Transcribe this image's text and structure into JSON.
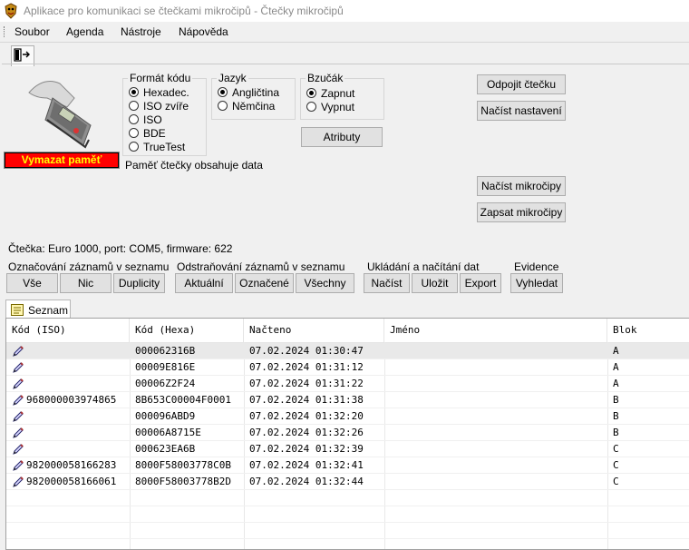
{
  "window": {
    "title": "Aplikace pro komunikaci se čtečkami mikročipů - Čtečky mikročipů"
  },
  "menu": [
    "Soubor",
    "Agenda",
    "Nástroje",
    "Nápověda"
  ],
  "erase_button": "Vymazat paměť",
  "code_format": {
    "label": "Formát kódu",
    "options": [
      "Hexadec.",
      "ISO zvíře",
      "ISO",
      "BDE",
      "TrueTest"
    ],
    "selected": 0
  },
  "language": {
    "label": "Jazyk",
    "options": [
      "Angličtina",
      "Němčina"
    ],
    "selected": 0
  },
  "beeper": {
    "label": "Bzučák",
    "options": [
      "Zapnut",
      "Vypnut"
    ],
    "selected": 0
  },
  "attributes_button": "Atributy",
  "memory_status": "Paměť čtečky obsahuje data",
  "right_buttons": {
    "disconnect": "Odpojit čtečku",
    "load_settings": "Načíst nastavení",
    "load_chips": "Načíst mikročipy",
    "write_chips": "Zapsat mikročipy"
  },
  "reader_status": "Čtečka: Euro 1000, port: COM5, firmware: 622",
  "segments": {
    "mark": {
      "label": "Označování záznamů v seznamu",
      "buttons": [
        "Vše",
        "Nic",
        "Duplicity"
      ]
    },
    "remove": {
      "label": "Odstraňování záznamů v seznamu",
      "buttons": [
        "Aktuální",
        "Označené",
        "Všechny"
      ]
    },
    "save": {
      "label": "Ukládání a načítání dat",
      "buttons": [
        "Načíst",
        "Uložit",
        "Export"
      ]
    },
    "evidence": {
      "label": "Evidence",
      "buttons": [
        "Vyhledat"
      ]
    }
  },
  "list_tab": "Seznam",
  "columns": [
    "Kód (ISO)",
    "Kód (Hexa)",
    "Načteno",
    "Jméno",
    "Blok"
  ],
  "rows": [
    {
      "iso": "",
      "hexa": "000062316B",
      "time": "07.02.2024 01:30:47",
      "name": "",
      "block": "A"
    },
    {
      "iso": "",
      "hexa": "00009E816E",
      "time": "07.02.2024 01:31:12",
      "name": "",
      "block": "A"
    },
    {
      "iso": "",
      "hexa": "00006Z2F24",
      "time": "07.02.2024 01:31:22",
      "name": "",
      "block": "A"
    },
    {
      "iso": "968000003974865",
      "hexa": "8B653C00004F0001",
      "time": "07.02.2024 01:31:38",
      "name": "",
      "block": "B"
    },
    {
      "iso": "",
      "hexa": "000096ABD9",
      "time": "07.02.2024 01:32:20",
      "name": "",
      "block": "B"
    },
    {
      "iso": "",
      "hexa": "00006A8715E",
      "time": "07.02.2024 01:32:26",
      "name": "",
      "block": "B"
    },
    {
      "iso": "",
      "hexa": "000623EA6B",
      "time": "07.02.2024 01:32:39",
      "name": "",
      "block": "C"
    },
    {
      "iso": "982000058166283",
      "hexa": "8000F58003778C0B",
      "time": "07.02.2024 01:32:41",
      "name": "",
      "block": "C"
    },
    {
      "iso": "982000058166061",
      "hexa": "8000F58003778B2D",
      "time": "07.02.2024 01:32:44",
      "name": "",
      "block": "C"
    }
  ]
}
